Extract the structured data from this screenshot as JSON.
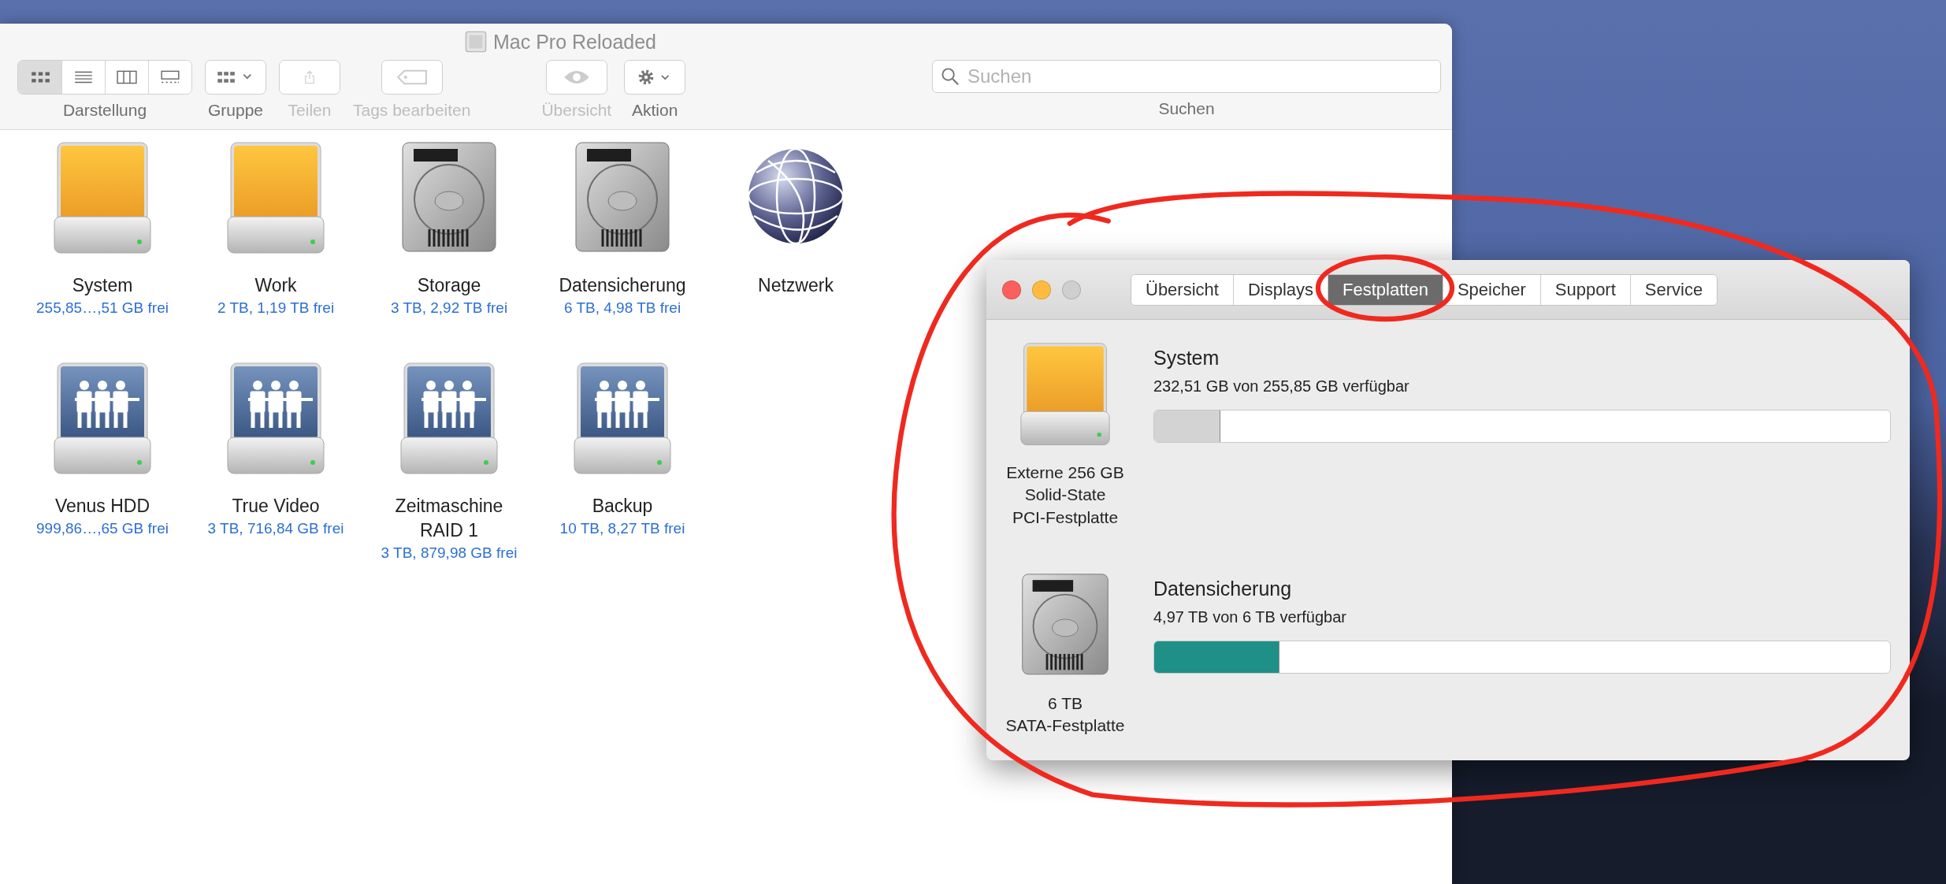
{
  "finder": {
    "title": "Mac Pro Reloaded",
    "toolbar": [
      {
        "kind": "view",
        "label": "Darstellung",
        "buttons": [
          {
            "kind": "icons",
            "selected": true
          },
          {
            "kind": "list",
            "selected": false
          },
          {
            "kind": "columns",
            "selected": false
          },
          {
            "kind": "gallery",
            "selected": false
          }
        ]
      },
      {
        "kind": "group",
        "label": "Gruppe",
        "disabled": false
      },
      {
        "kind": "share",
        "label": "Teilen",
        "disabled": true
      },
      {
        "kind": "tags",
        "label": "Tags bearbeiten",
        "disabled": true
      },
      {
        "kind": "preview",
        "label": "Übersicht",
        "disabled": true
      },
      {
        "kind": "action",
        "label": "Aktion",
        "disabled": false
      }
    ],
    "search": {
      "placeholder": "Suchen",
      "label": "Suchen"
    },
    "items": [
      {
        "kind": "ssd",
        "name": "System",
        "detail": "255,85…,51 GB frei"
      },
      {
        "kind": "ssd",
        "name": "Work",
        "detail": "2 TB, 1,19 TB frei"
      },
      {
        "kind": "hdd",
        "name": "Storage",
        "detail": "3 TB, 2,92 TB frei"
      },
      {
        "kind": "hdd",
        "name": "Datensicherung",
        "detail": "6 TB, 4,98 TB frei"
      },
      {
        "kind": "network",
        "name": "Netzwerk"
      },
      {
        "kind": "server",
        "name": "Venus HDD",
        "detail": "999,86…,65 GB frei"
      },
      {
        "kind": "server",
        "name": "True Video",
        "detail": "3 TB, 716,84 GB frei"
      },
      {
        "kind": "server",
        "name": "Zeitmaschine RAID 1",
        "detail": "3 TB, 879,98 GB frei"
      },
      {
        "kind": "server",
        "name": "Backup",
        "detail": "10 TB, 8,27 TB frei"
      }
    ]
  },
  "about": {
    "controls": [
      {
        "kind": "close",
        "disabled": false
      },
      {
        "kind": "minimize",
        "disabled": false
      },
      {
        "kind": "zoom",
        "disabled": true
      }
    ],
    "tabs": [
      {
        "label": "Übersicht",
        "selected": false
      },
      {
        "label": "Displays",
        "selected": false
      },
      {
        "label": "Festplatten",
        "selected": true
      },
      {
        "label": "Speicher",
        "selected": false
      },
      {
        "label": "Support",
        "selected": false
      },
      {
        "label": "Service",
        "selected": false
      }
    ],
    "disks": [
      {
        "kind": "ssd",
        "caption": [
          "Externe 256 GB",
          "Solid-State",
          "PCI-Festplatte"
        ],
        "name": "System",
        "availability": "232,51 GB von 255,85 GB verfügbar",
        "level": 0.09,
        "color": "#d3d3d3"
      },
      {
        "kind": "hdd",
        "caption": [
          "6 TB",
          "SATA-Festplatte"
        ],
        "name": "Datensicherung",
        "availability": "4,97 TB von 6 TB verfügbar",
        "level": 0.17,
        "color": "#1e9087"
      }
    ]
  }
}
